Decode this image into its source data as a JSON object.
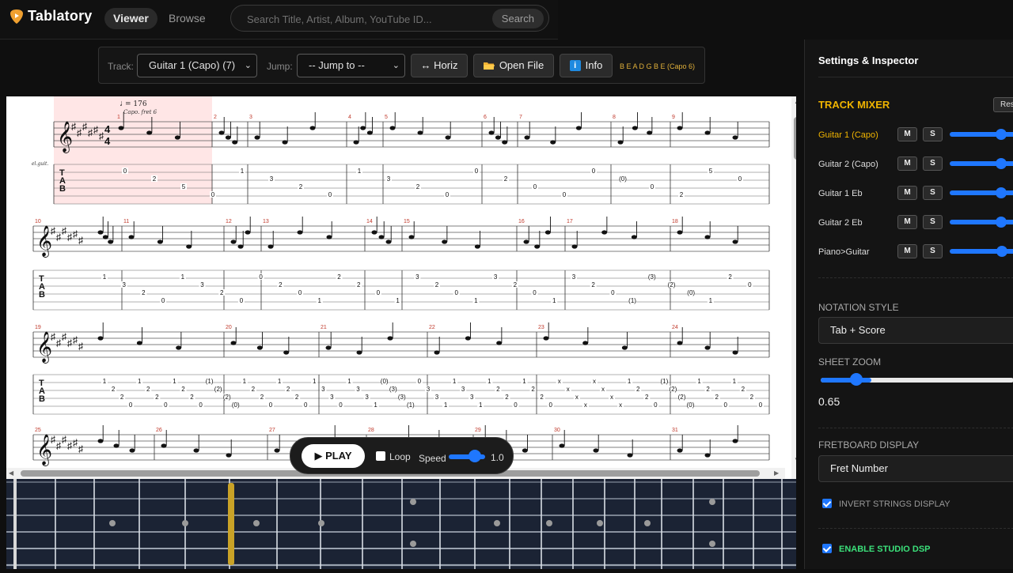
{
  "app": {
    "name": "Tablatory"
  },
  "nav": {
    "tabs": [
      "Viewer",
      "Browse"
    ]
  },
  "search": {
    "placeholder": "Search Title, Artist, Album, YouTube ID...",
    "button": "Search"
  },
  "toolbar": {
    "track_label": "Track:",
    "track_value": "Guitar 1 (Capo) (7)",
    "jump_label": "Jump:",
    "jump_value": "-- Jump to --",
    "horiz": "↔ Horiz",
    "open_file": "Open File",
    "info": "Info",
    "tuning": "B E A D G B E (Capo 6)"
  },
  "score": {
    "tempo": "= 176",
    "capo_note": "Capo. fret 6",
    "instrument": "el.guit.",
    "measure_numbers": [
      [
        "1",
        "2",
        "3",
        "4",
        "5",
        "6",
        "7",
        "8",
        "9"
      ],
      [
        "10",
        "11",
        "12",
        "13",
        "14",
        "15",
        "16",
        "17",
        "18"
      ],
      [
        "19",
        "20",
        "21",
        "22",
        "23",
        "24"
      ],
      [
        "25",
        "26",
        "27",
        "28",
        "29",
        "30",
        "31"
      ]
    ],
    "tab_numbers_sys1": [
      "0",
      "2",
      "5",
      "0",
      "1",
      "3",
      "2",
      "0",
      "1",
      "3",
      "2",
      "0",
      "0",
      "2",
      "0",
      "0",
      "0",
      "(0)",
      "0",
      "2",
      "5",
      "0"
    ],
    "tab_numbers_sys2": [
      "1",
      "3",
      "2",
      "0",
      "1",
      "3",
      "2",
      "0",
      "0",
      "2",
      "0",
      "1",
      "2",
      "2",
      "0",
      "1",
      "3",
      "2",
      "0",
      "1",
      "3",
      "2",
      "0",
      "1",
      "3",
      "2",
      "0",
      "(1)",
      "(3)",
      "(2)",
      "(0)",
      "1",
      "2",
      "0"
    ],
    "tab_numbers_sys3": [
      "1",
      "2",
      "2",
      "0",
      "1",
      "2",
      "2",
      "0",
      "1",
      "2",
      "2",
      "0",
      "(1)",
      "(2)",
      "(2)",
      "(0)",
      "1",
      "2",
      "2",
      "0",
      "1",
      "2",
      "2",
      "0",
      "1",
      "3",
      "3",
      "0",
      "1",
      "3",
      "3",
      "1",
      "(0)",
      "(3)",
      "(3)",
      "(1)",
      "0",
      "3",
      "3",
      "1",
      "1",
      "3",
      "3",
      "1",
      "1",
      "2",
      "2",
      "0",
      "1",
      "2",
      "2",
      "0",
      "x",
      "x",
      "x",
      "x",
      "x",
      "x",
      "x",
      "x",
      "1",
      "2",
      "2",
      "0",
      "(1)",
      "(2)",
      "(2)",
      "(0)",
      "1",
      "2",
      "2",
      "0",
      "1",
      "2",
      "2",
      "0"
    ]
  },
  "playback": {
    "play": "PLAY",
    "loop": "Loop",
    "speed_label": "Speed",
    "speed_value": "1.0",
    "speed_level": 0.65
  },
  "inspector": {
    "title": "Settings & Inspector",
    "mixer_title": "TRACK MIXER",
    "reset": "Res",
    "tracks": [
      {
        "name": "Guitar 1 (Capo)",
        "m": "M",
        "s": "S",
        "volume": 0.78
      },
      {
        "name": "Guitar 2 (Capo)",
        "m": "M",
        "s": "S",
        "volume": 0.78
      },
      {
        "name": "Guitar 1 Eb",
        "m": "M",
        "s": "S",
        "volume": 0.78
      },
      {
        "name": "Guitar 2 Eb",
        "m": "M",
        "s": "S",
        "volume": 0.78
      },
      {
        "name": "Piano>Guitar",
        "m": "M",
        "s": "S",
        "volume": 0.8
      }
    ],
    "notation_label": "NOTATION STYLE",
    "notation_value": "Tab + Score",
    "zoom_label": "SHEET ZOOM",
    "zoom_value": "0.65",
    "fretboard_label": "FRETBOARD DISPLAY",
    "fretboard_value": "Fret Number",
    "invert_label": "INVERT STRINGS DISPLAY",
    "dsp_label": "ENABLE STUDIO DSP"
  },
  "colors": {
    "accent": "#1f77ff",
    "gold": "#f0b400",
    "dsp_green": "#3be07a",
    "highlight": "#ffe6e6"
  }
}
